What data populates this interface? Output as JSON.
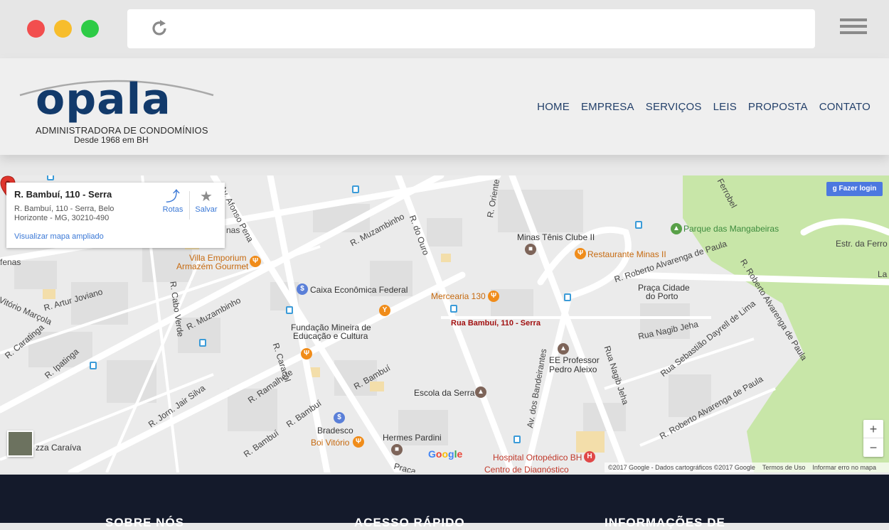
{
  "browser": {
    "traffic_lights": [
      "close",
      "minimize",
      "maximize"
    ],
    "reload_icon": "reload-icon",
    "menu_icon": "hamburger-menu-icon"
  },
  "header": {
    "logo_word": "opala",
    "logo_subtitle": "ADMINISTRADORA DE CONDOMÍNIOS",
    "logo_since": "Desde 1968 em BH",
    "brand_color": "#123a6b",
    "nav": [
      "HOME",
      "EMPRESA",
      "SERVIÇOS",
      "LEIS",
      "PROPOSTA",
      "CONTATO"
    ]
  },
  "map": {
    "card": {
      "title": "R. Bambuí, 110 - Serra",
      "address": "R. Bambuí, 110 - Serra, Belo Horizonte - MG, 30210-490",
      "link": "Visualizar mapa ampliado",
      "route_label": "Rotas",
      "save_label": "Salvar"
    },
    "login_label": "Fazer login",
    "pin_label": "Rua Bambuí, 110 - Serra",
    "zoom_in": "+",
    "zoom_out": "−",
    "google_logo": "Google",
    "attribution": {
      "copyright": "©2017 Google - Dados cartográficos ©2017 Google",
      "terms": "Termos de Uso",
      "report": "Informar erro no mapa"
    },
    "places": {
      "minas_tenis": "Minas Tênis Clube II",
      "restaurante": "Restaurante Minas II",
      "parque": "Parque das Mangabeiras",
      "villa1": "Villa Emporium",
      "villa2": "Armazém Gourmet",
      "caixa": "Caixa Econômica Federal",
      "mercearia": "Mercearia 130",
      "fund1": "Fundação Mineira de",
      "fund2": "Educação e Cultura",
      "praca1": "Praça Cidade",
      "praca2": "do Porto",
      "ee1": "EE Professor",
      "ee2": "Pedro Aleixo",
      "escola": "Escola da Serra",
      "bradesco": "Bradesco",
      "boi": "Boi Vitório",
      "hermes": "Hermes Pardini",
      "hospital": "Hospital Ortopédico BH",
      "centro": "Centro de Diagnóstico",
      "pizza": "zza Caraíva"
    },
    "streets": {
      "afonso": "Av. Afonso Pena",
      "muzambinho1": "R. Muzambinho",
      "muzambinho2": "R. Muzambinho",
      "ouro": "R. do Ouro",
      "oriente": "R. Oriente",
      "ferrobel": "Ferrobel",
      "estr": "Estr. da Ferro",
      "la": "La",
      "alvarenga1": "R. Roberto Alvarenga de Paula",
      "alvarenga2": "R. Roberto Alvarenga de Paula",
      "alvarenga3": "R. Roberto Alvarenga de Paula",
      "nagib": "Rua Nagib Jeha",
      "nagib2": "Rua Nagib Jeha",
      "lima": "Rua Sebastião Dayrell de Lima",
      "bandeirantes": "Av. dos Bandeirantes",
      "joviano": "R. Artur Joviano",
      "marcola": "Vitório Marçola",
      "caratinga": "R. Caratinga",
      "ipatinga": "R. Ipatinga",
      "cabo": "R. Cabo Verde",
      "caracol": "R. Caracol",
      "ramalhete": "R. Ramalhete",
      "jair": "R. Jorn. Jair Silva",
      "bambui1": "R. Bambuí",
      "bambui2": "R. Bambuí",
      "bambui3": "R. Bambuí",
      "fenas": "fenas",
      "nas": "nas",
      "praca": "Praça"
    }
  },
  "footer": {
    "col1": "SOBRE NÓS",
    "col2": "ACESSO RÁPIDO",
    "col3": "INFORMAÇÕES DE"
  }
}
